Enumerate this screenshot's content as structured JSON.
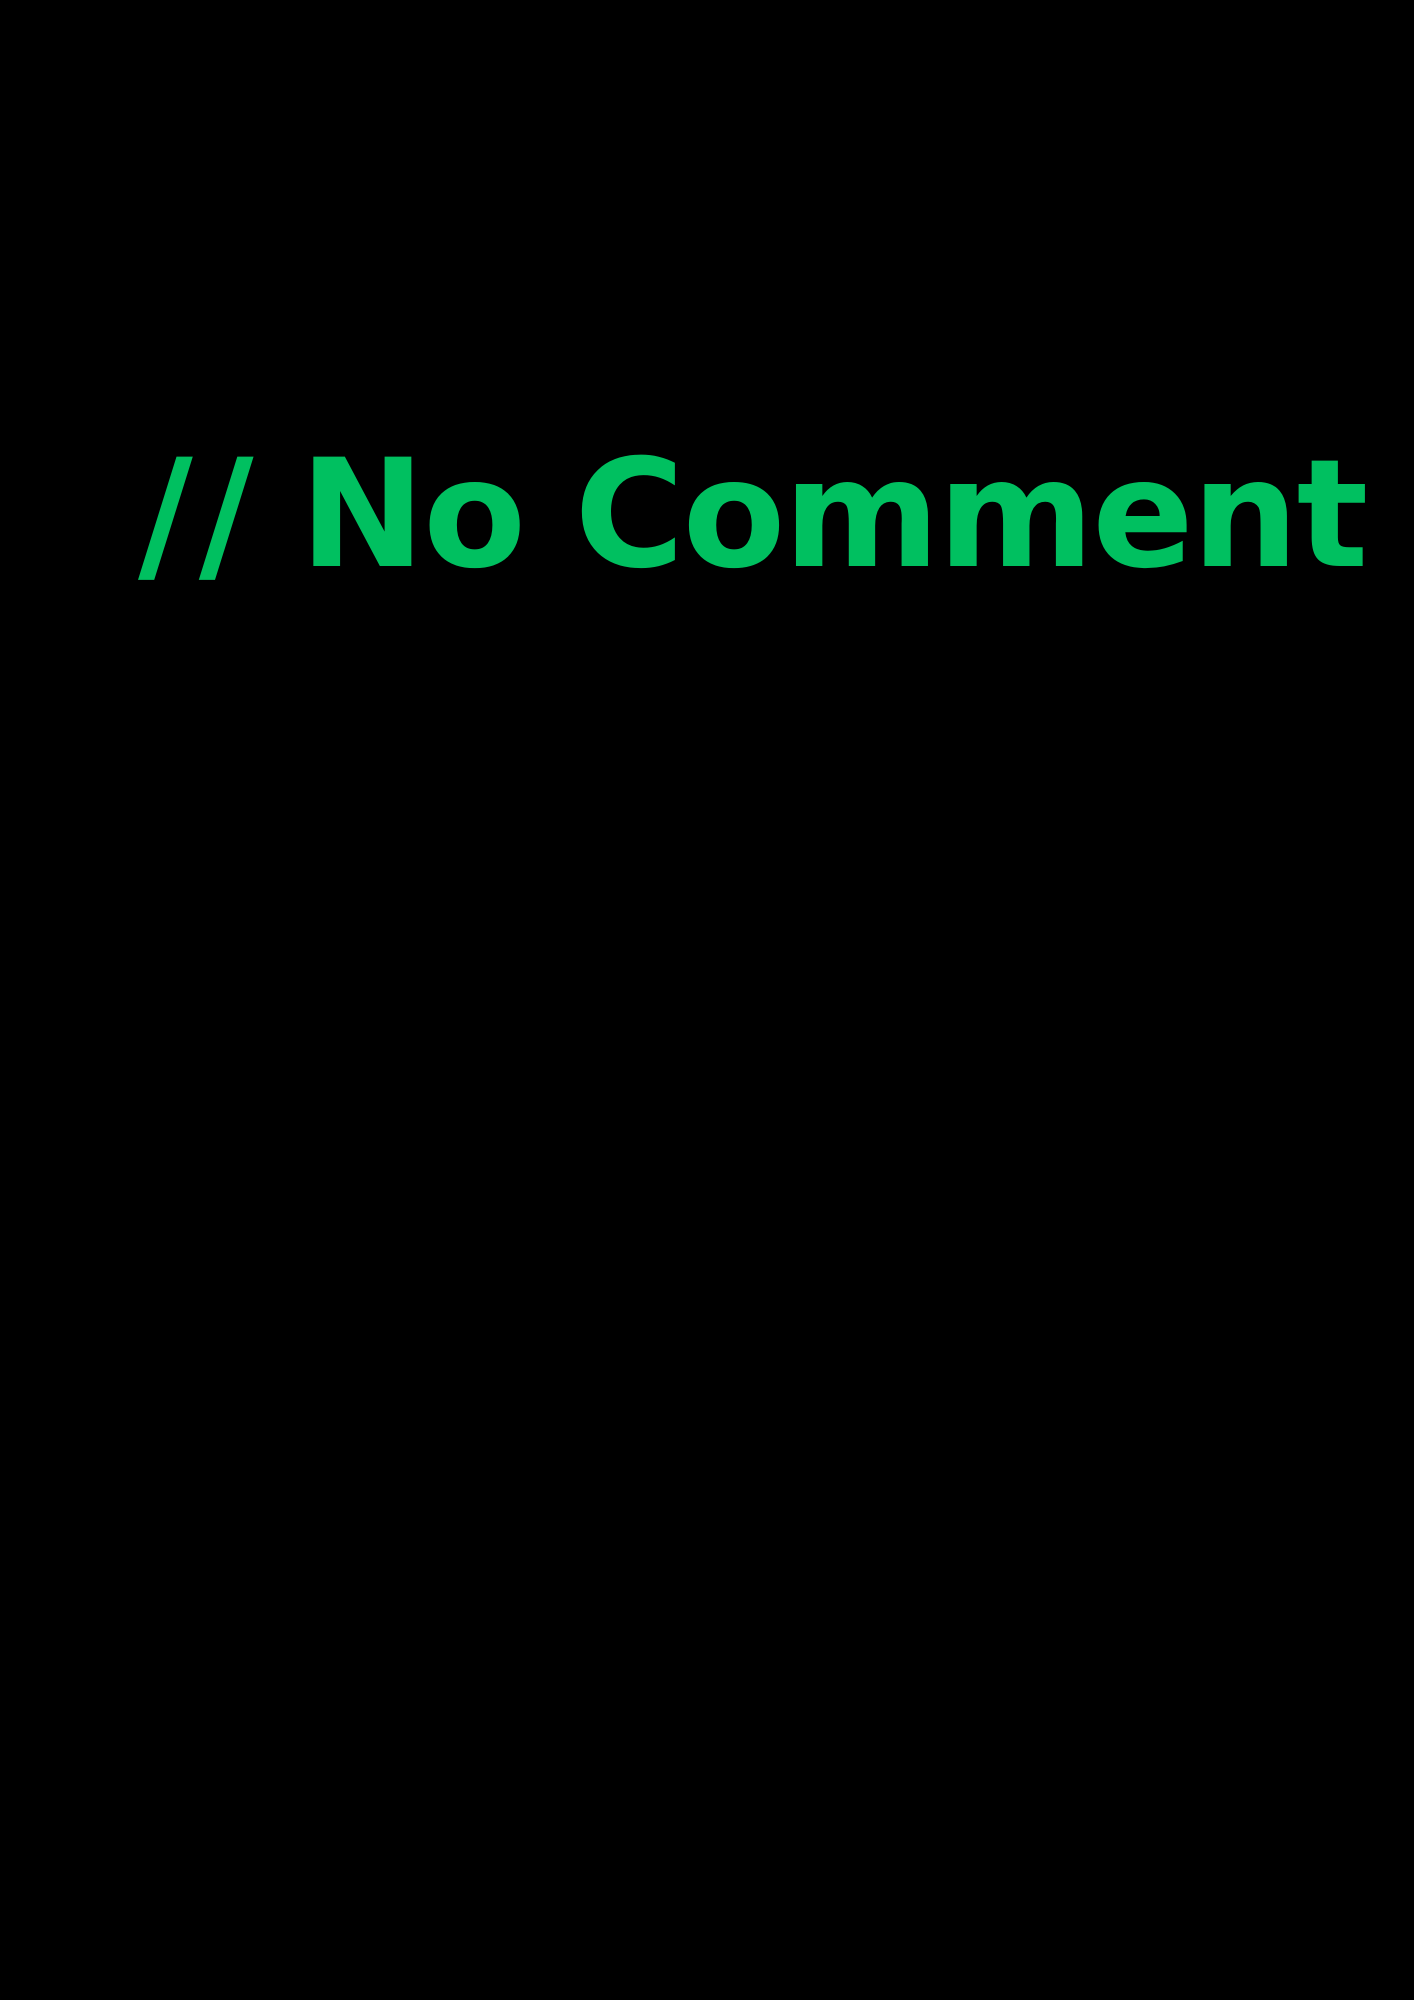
{
  "comment": {
    "marker": "//",
    "text": "No Comment"
  },
  "colors": {
    "background": "#000000",
    "text": "#00c060"
  }
}
